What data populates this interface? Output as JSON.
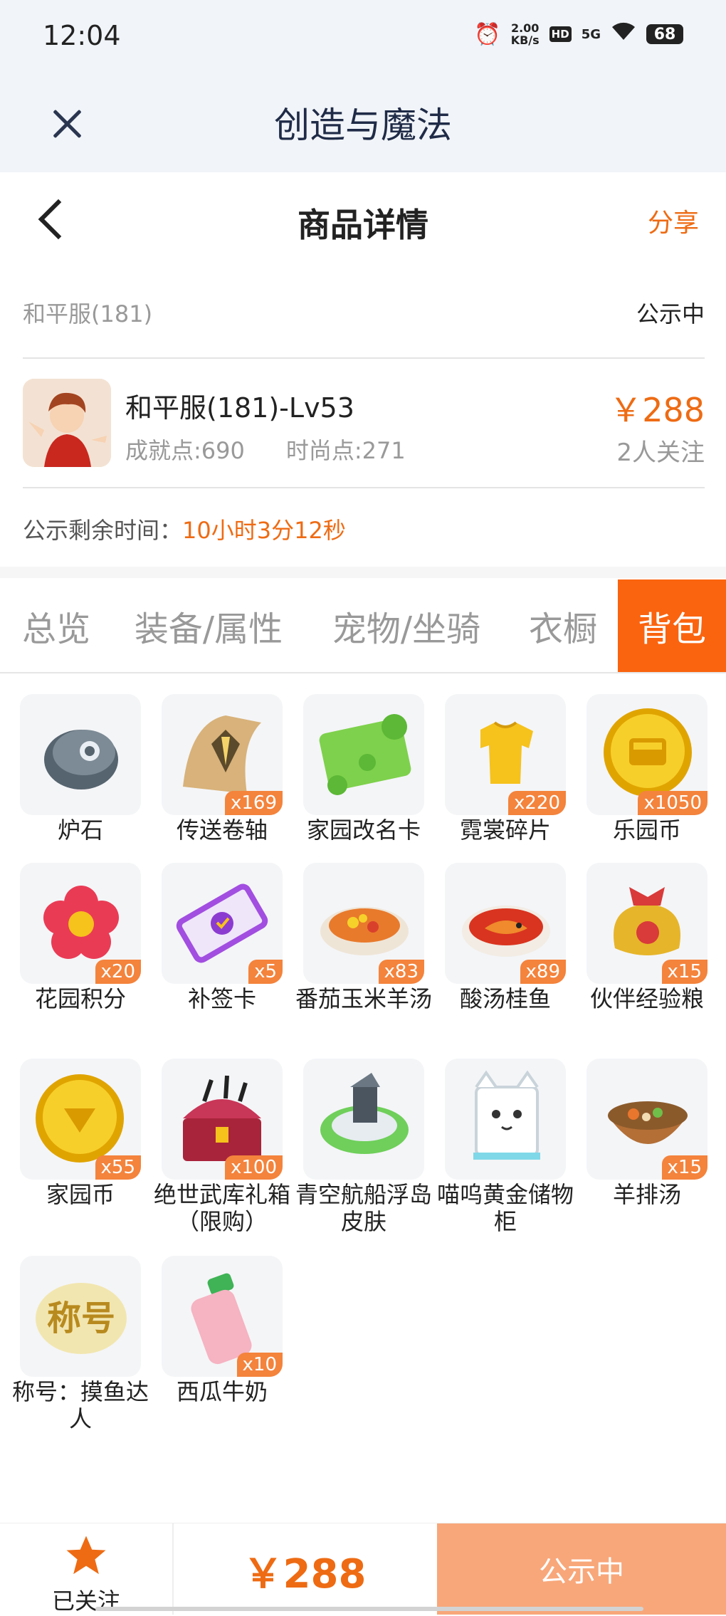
{
  "status_bar": {
    "time": "12:04",
    "net_speed": "2.00",
    "net_unit": "KB/s",
    "hd": "HD",
    "network": "5G",
    "battery": "68"
  },
  "web_header": {
    "title": "创造与魔法"
  },
  "nav": {
    "title": "商品详情",
    "share": "分享"
  },
  "listing": {
    "server": "和平服(181)",
    "status": "公示中",
    "name": "和平服(181)-Lv53",
    "achievement": "成就点:690",
    "fashion": "时尚点:271",
    "price": "￥288",
    "followers": "2人关注",
    "timer_label": "公示剩余时间：",
    "timer_value": "10小时3分12秒"
  },
  "tabs": [
    {
      "label": "总览"
    },
    {
      "label": "装备/属性"
    },
    {
      "label": "宠物/坐骑"
    },
    {
      "label": "衣橱"
    },
    {
      "label": "背包"
    }
  ],
  "active_tab": "背包",
  "items": [
    {
      "name": "炉石",
      "count": "",
      "icon": "stone-icon"
    },
    {
      "name": "传送卷轴",
      "count": "x169",
      "icon": "scroll-icon"
    },
    {
      "name": "家园改名卡",
      "count": "",
      "icon": "rename-card-icon"
    },
    {
      "name": "霓裳碎片",
      "count": "x220",
      "icon": "shirt-icon"
    },
    {
      "name": "乐园币",
      "count": "x1050",
      "icon": "coin-icon"
    },
    {
      "name": "花园积分",
      "count": "x20",
      "icon": "flower-icon"
    },
    {
      "name": "补签卡",
      "count": "x5",
      "icon": "ticket-icon"
    },
    {
      "name": "番茄玉米羊汤",
      "count": "x83",
      "icon": "soup-icon"
    },
    {
      "name": "酸汤桂鱼",
      "count": "x89",
      "icon": "fish-icon"
    },
    {
      "name": "伙伴经验粮",
      "count": "x15",
      "icon": "bag-icon"
    },
    {
      "name": "家园币",
      "count": "x55",
      "icon": "coin-icon"
    },
    {
      "name": "绝世武库礼箱（限购）",
      "count": "x100",
      "icon": "chest-icon"
    },
    {
      "name": "青空航船浮岛皮肤",
      "count": "",
      "icon": "island-icon"
    },
    {
      "name": "喵呜黄金储物柜",
      "count": "",
      "icon": "cat-cabinet-icon"
    },
    {
      "name": "羊排汤",
      "count": "x15",
      "icon": "bowl-icon"
    },
    {
      "name": "称号：摸鱼达人",
      "count": "",
      "icon": "title-icon"
    },
    {
      "name": "西瓜牛奶",
      "count": "x10",
      "icon": "bottle-icon"
    }
  ],
  "bottom_bar": {
    "follow_label": "已关注",
    "price": "￥288",
    "status": "公示中"
  },
  "colors": {
    "accent": "#ee6b13",
    "tab_active": "#fa640f",
    "status_button": "#f8a77a"
  }
}
